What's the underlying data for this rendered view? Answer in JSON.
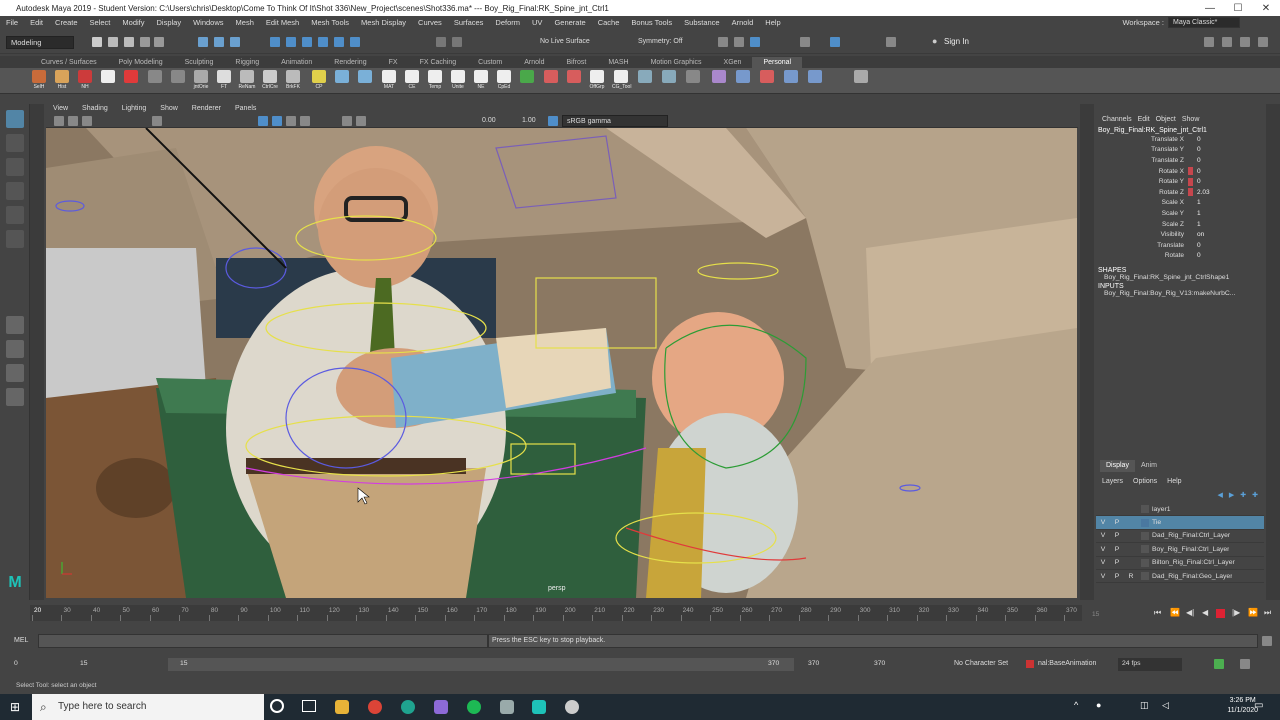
{
  "title": "Autodesk Maya 2019 - Student Version: C:\\Users\\chris\\Desktop\\Come To Think Of It\\Shot 336\\New_Project\\scenes\\Shot336.ma* --- Boy_Rig_Final:RK_Spine_jnt_Ctrl1",
  "window_controls": {
    "min": "—",
    "max": "☐",
    "close": "✕"
  },
  "menubar": [
    "File",
    "Edit",
    "Create",
    "Select",
    "Modify",
    "Display",
    "Windows",
    "Mesh",
    "Edit Mesh",
    "Mesh Tools",
    "Mesh Display",
    "Curves",
    "Surfaces",
    "Deform",
    "UV",
    "Generate",
    "Cache",
    "Bonus Tools",
    "Substance",
    "Arnold",
    "Help"
  ],
  "workspace": {
    "label": "Workspace :",
    "value": "Maya Classic*"
  },
  "status_line": {
    "menu_set": "Modeling",
    "live_surface": "No Live Surface",
    "symmetry": "Symmetry: Off",
    "sign_in": "Sign In"
  },
  "shelf_tabs": [
    "Curves / Surfaces",
    "Poly Modeling",
    "Sculpting",
    "Rigging",
    "Animation",
    "Rendering",
    "FX",
    "FX Caching",
    "Custom",
    "Arnold",
    "Bifrost",
    "MASH",
    "Motion Graphics",
    "XGen",
    "Personal"
  ],
  "shelf_active": "Personal",
  "shelf_buttons": [
    "SelH",
    "Hist",
    "NH",
    "",
    "",
    "",
    "jntOrie",
    "FT",
    "ReNam",
    "CtrlCre",
    "BrkFK",
    "CP",
    "",
    "MAT",
    "CE",
    "Temp",
    "Unite",
    "NE",
    "CpEd",
    "",
    "OffGrp",
    "CG_Tool",
    "",
    "",
    "",
    "",
    "",
    ""
  ],
  "panel_menu": [
    "View",
    "Shading",
    "Lighting",
    "Show",
    "Renderer",
    "Panels"
  ],
  "panel_toolbar": {
    "near": "0.00",
    "far": "1.00",
    "colorspace": "sRGB gamma"
  },
  "viewport": {
    "camera": "persp"
  },
  "channel_box": {
    "menu": [
      "Channels",
      "Edit",
      "Object",
      "Show"
    ],
    "object": "Boy_Rig_Final:RK_Spine_jnt_Ctrl1",
    "attributes": [
      {
        "name": "Translate X",
        "value": "0",
        "keyed": false
      },
      {
        "name": "Translate Y",
        "value": "0",
        "keyed": false
      },
      {
        "name": "Translate Z",
        "value": "0",
        "keyed": false
      },
      {
        "name": "Rotate X",
        "value": "0",
        "keyed": true
      },
      {
        "name": "Rotate Y",
        "value": "0",
        "keyed": true
      },
      {
        "name": "Rotate Z",
        "value": "2.03",
        "keyed": true
      },
      {
        "name": "Scale X",
        "value": "1",
        "keyed": false
      },
      {
        "name": "Scale Y",
        "value": "1",
        "keyed": false
      },
      {
        "name": "Scale Z",
        "value": "1",
        "keyed": false
      },
      {
        "name": "Visibility",
        "value": "on",
        "keyed": false
      },
      {
        "name": "Translate",
        "value": "0",
        "keyed": false
      },
      {
        "name": "Rotate",
        "value": "0",
        "keyed": false
      }
    ],
    "shapes_label": "SHAPES",
    "shape": "Boy_Rig_Final:RK_Spine_jnt_CtrlShape1",
    "inputs_label": "INPUTS",
    "input": "Boy_Rig_Final:Boy_Rig_V13:makeNurbC..."
  },
  "layer_editor": {
    "tabs": [
      "Display",
      "Anim"
    ],
    "menu": [
      "Layers",
      "Options",
      "Help"
    ],
    "layers": [
      {
        "v": "",
        "p": "",
        "r": "",
        "name": "layer1",
        "color": "#555555",
        "selected": false
      },
      {
        "v": "V",
        "p": "P",
        "r": "",
        "name": "Tie",
        "color": "#4a78a0",
        "selected": true
      },
      {
        "v": "V",
        "p": "P",
        "r": "",
        "name": "Dad_Rig_Final:Ctrl_Layer",
        "color": "#555555",
        "selected": false
      },
      {
        "v": "V",
        "p": "P",
        "r": "",
        "name": "Boy_Rig_Final:Ctrl_Layer",
        "color": "#555555",
        "selected": false
      },
      {
        "v": "V",
        "p": "P",
        "r": "",
        "name": "Bilton_Rig_Final:Ctrl_Layer",
        "color": "#555555",
        "selected": false
      },
      {
        "v": "V",
        "p": "P",
        "r": "R",
        "name": "Dad_Rig_Final:Geo_Layer",
        "color": "#555555",
        "selected": false
      }
    ]
  },
  "timeline": {
    "labels": [
      "20",
      "30",
      "40",
      "50",
      "60",
      "70",
      "80",
      "90",
      "100",
      "110",
      "120",
      "130",
      "140",
      "150",
      "160",
      "170",
      "180",
      "190",
      "200",
      "210",
      "220",
      "230",
      "240",
      "250",
      "260",
      "270",
      "280",
      "290",
      "300",
      "310",
      "320",
      "330",
      "340",
      "350",
      "360",
      "370"
    ],
    "current_frame": "20",
    "end_label": "15"
  },
  "command_line": {
    "label": "MEL",
    "message": "Press the ESC key to stop playback."
  },
  "range_slider": {
    "start": "0",
    "playback_start": "15",
    "slider_start": "15",
    "slider_end": "370",
    "playback_end": "370",
    "end": "370",
    "character_set": "No Character Set",
    "anim_layer": "nal:BaseAnimation",
    "fps": "24 fps"
  },
  "help_line": "Select Tool: select an object",
  "taskbar": {
    "search_placeholder": "Type here to search",
    "time": "3:26 PM",
    "date": "11/1/2020"
  }
}
